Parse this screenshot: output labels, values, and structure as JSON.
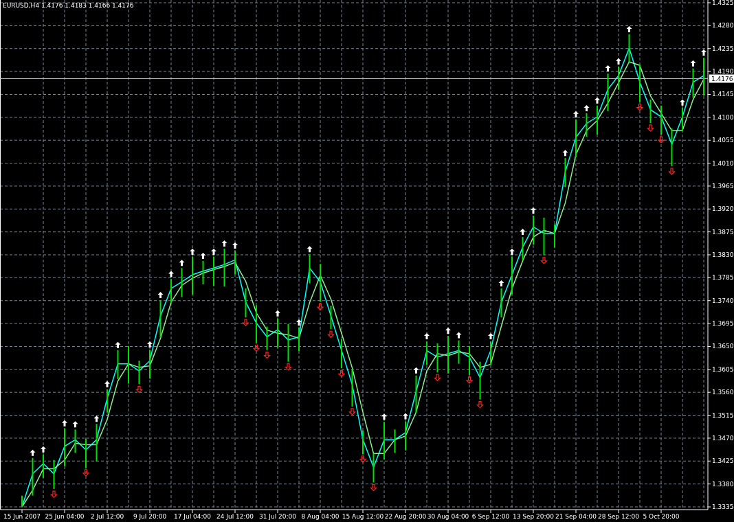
{
  "header": {
    "symbol": "EURUSD,H4",
    "quotes": [
      "1.4176",
      "1.4183",
      "1.4166",
      "1.4176"
    ]
  },
  "chart_data": {
    "type": "line",
    "grid": true,
    "categories": [
      "15 Jun 2007",
      null,
      null,
      null,
      "25 Jun 04:00",
      null,
      null,
      null,
      "2 Jul 12:00",
      null,
      null,
      null,
      "9 Jul 20:00",
      null,
      null,
      null,
      "17 Jul 04:00",
      null,
      null,
      null,
      "24 Jul 12:00",
      null,
      null,
      null,
      "31 Jul 20:00",
      null,
      null,
      null,
      "8 Aug 04:00",
      null,
      null,
      null,
      "15 Aug 12:00",
      null,
      null,
      null,
      "22 Aug 20:00",
      null,
      null,
      null,
      "30 Aug 04:00",
      null,
      null,
      null,
      "6 Sep 12:00",
      null,
      null,
      null,
      "13 Sep 20:00",
      null,
      null,
      null,
      "21 Sep 04:00",
      null,
      null,
      null,
      "28 Sep 12:00",
      null,
      null,
      null,
      "5 Oct 20:00",
      null,
      null,
      null,
      null
    ],
    "ylim": [
      1.3335,
      1.4325
    ],
    "yticks": [
      {
        "value": 1.3335,
        "label": "1.3335"
      },
      {
        "value": 1.338,
        "label": "1.3380"
      },
      {
        "value": 1.3425,
        "label": "1.3425"
      },
      {
        "value": 1.347,
        "label": "1.3470"
      },
      {
        "value": 1.3515,
        "label": "1.3515"
      },
      {
        "value": 1.356,
        "label": "1.3560"
      },
      {
        "value": 1.3605,
        "label": "1.3605"
      },
      {
        "value": 1.365,
        "label": "1.3650"
      },
      {
        "value": 1.3695,
        "label": "1.3695"
      },
      {
        "value": 1.374,
        "label": "1.3740"
      },
      {
        "value": 1.3785,
        "label": "1.3785"
      },
      {
        "value": 1.383,
        "label": "1.3830"
      },
      {
        "value": 1.3875,
        "label": "1.3875"
      },
      {
        "value": 1.392,
        "label": "1.3920"
      },
      {
        "value": 1.3965,
        "label": "1.3965"
      },
      {
        "value": 1.401,
        "label": "1.4010"
      },
      {
        "value": 1.4055,
        "label": "1.4055"
      },
      {
        "value": 1.41,
        "label": "1.4100"
      },
      {
        "value": 1.4145,
        "label": "1.4145"
      },
      {
        "value": 1.419,
        "label": "1.4190"
      },
      {
        "value": 1.4235,
        "label": "1.4235"
      },
      {
        "value": 1.428,
        "label": "1.4280"
      },
      {
        "value": 1.4325,
        "label": "1.4325"
      }
    ],
    "ref_lines": [
      {
        "axis": "y",
        "value": 1.4176,
        "label": "1.4176"
      }
    ],
    "series": [
      {
        "color": "#00ffff",
        "values": [
          1.3335,
          1.34,
          1.342,
          1.34,
          1.3454,
          1.3467,
          1.3447,
          1.3467,
          1.3548,
          1.3616,
          1.3616,
          1.3602,
          1.3622,
          1.371,
          1.3764,
          1.3777,
          1.3791,
          1.3798,
          1.3804,
          1.3811,
          1.382,
          1.3737,
          1.3696,
          1.3669,
          1.3683,
          1.3663,
          1.3669,
          1.3804,
          1.3777,
          1.371,
          1.3642,
          1.3575,
          1.3467,
          1.3413,
          1.3467,
          1.3467,
          1.3481,
          1.3562,
          1.3642,
          1.3629,
          1.3636,
          1.3642,
          1.3629,
          1.3589,
          1.3642,
          1.3737,
          1.3791,
          1.3845,
          1.3885,
          1.3872,
          1.3872,
          1.3993,
          1.4061,
          1.4088,
          1.4101,
          1.4155,
          1.4182,
          1.4236,
          1.4169,
          1.4115,
          1.4101,
          1.4047,
          1.4101,
          1.4169,
          1.4182
        ]
      },
      {
        "color": "#90ee90",
        "values": [
          1.3335,
          1.3368,
          1.341,
          1.341,
          1.3427,
          1.346,
          1.3457,
          1.3457,
          1.3507,
          1.3582,
          1.3616,
          1.3609,
          1.3612,
          1.3666,
          1.3737,
          1.377,
          1.3784,
          1.3794,
          1.3801,
          1.3807,
          1.3815,
          1.3778,
          1.3716,
          1.3682,
          1.3676,
          1.3673,
          1.3666,
          1.3736,
          1.379,
          1.3743,
          1.3676,
          1.3608,
          1.3521,
          1.344,
          1.344,
          1.3467,
          1.3474,
          1.3521,
          1.3602,
          1.3636,
          1.3632,
          1.3639,
          1.3636,
          1.3609,
          1.3615,
          1.369,
          1.3764,
          1.3818,
          1.3865,
          1.3878,
          1.3872,
          1.3932,
          1.4027,
          1.4074,
          1.4094,
          1.4128,
          1.4168,
          1.4209,
          1.4202,
          1.4142,
          1.4108,
          1.4074,
          1.4074,
          1.4135,
          1.4175
        ]
      }
    ]
  }
}
